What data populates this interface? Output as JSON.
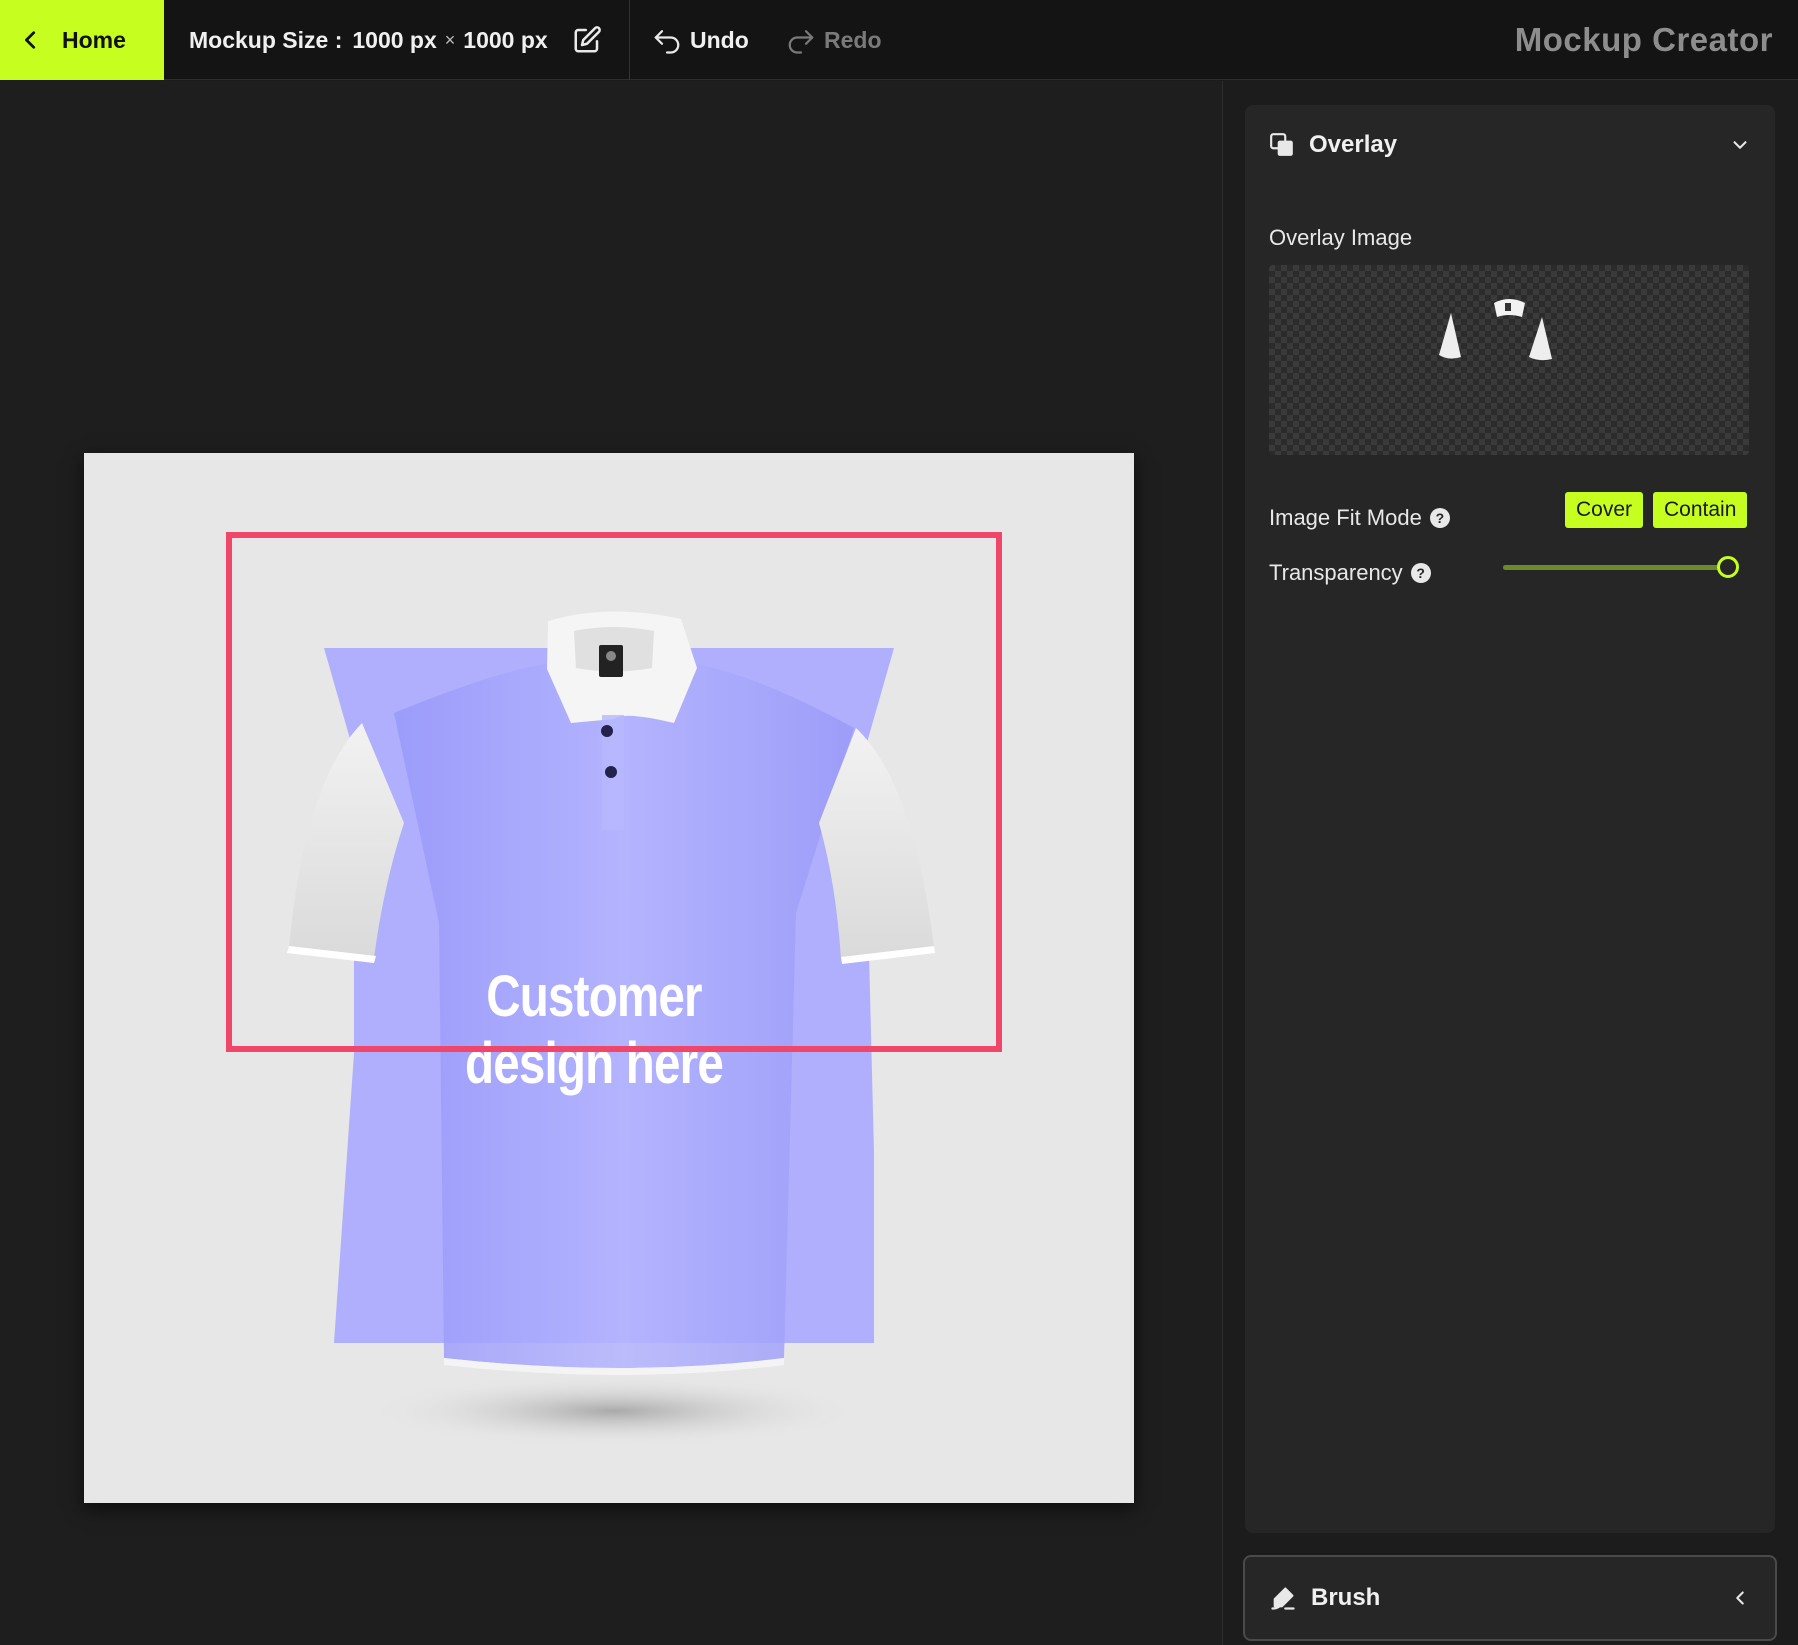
{
  "topbar": {
    "home_label": "Home",
    "size_prefix": "Mockup Size :",
    "width_value": "1000 px",
    "times_symbol": "×",
    "height_value": "1000 px",
    "undo_label": "Undo",
    "redo_label": "Redo",
    "app_title": "Mockup Creator"
  },
  "canvas": {
    "design_placeholder": "Customer design here",
    "print_area_color": "#f0466a",
    "shirt_tint": "#aaaaff"
  },
  "overlay_panel": {
    "title": "Overlay",
    "overlay_image_label": "Overlay Image",
    "fit_mode_label": "Image Fit Mode",
    "fit_options": [
      "Cover",
      "Contain"
    ],
    "transparency_label": "Transparency",
    "transparency_value": 1.0,
    "help_glyph": "?"
  },
  "brush_panel": {
    "title": "Brush"
  },
  "colors": {
    "accent": "#c6ff1f",
    "background": "#1c1c1c",
    "panel": "#262626",
    "title_gray": "#8d8d8d"
  }
}
